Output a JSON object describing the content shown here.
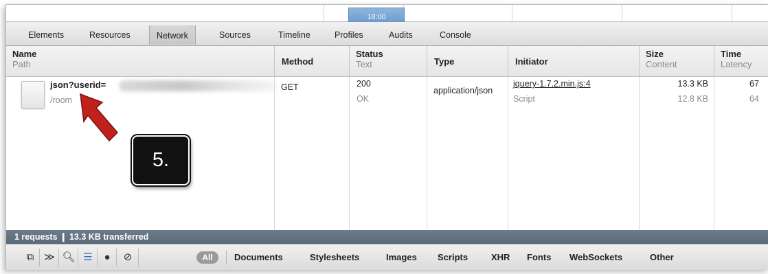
{
  "page_strip": {
    "time_label": "18:00"
  },
  "tabs": [
    {
      "label": "Elements",
      "active": false
    },
    {
      "label": "Resources",
      "active": false
    },
    {
      "label": "Network",
      "active": true
    },
    {
      "label": "Sources",
      "active": false
    },
    {
      "label": "Timeline",
      "active": false
    },
    {
      "label": "Profiles",
      "active": false
    },
    {
      "label": "Audits",
      "active": false
    },
    {
      "label": "Console",
      "active": false
    }
  ],
  "columns": {
    "name": {
      "title": "Name",
      "sub": "Path"
    },
    "method": {
      "title": "Method"
    },
    "status": {
      "title": "Status",
      "sub": "Text"
    },
    "type": {
      "title": "Type"
    },
    "initiator": {
      "title": "Initiator"
    },
    "size": {
      "title": "Size",
      "sub": "Content"
    },
    "time": {
      "title": "Time",
      "sub": "Latency"
    }
  },
  "request": {
    "name": "json?userid=",
    "path": "/room",
    "method": "GET",
    "status_code": "200",
    "status_text": "OK",
    "type": "application/json",
    "initiator": "jquery-1.7.2.min.js:4",
    "initiator_type": "Script",
    "size": "13.3 KB",
    "content": "12.8 KB",
    "time": "67",
    "latency": "64"
  },
  "annotation": {
    "step": "5."
  },
  "status_bar": {
    "summary": "1 requests  ❙  13.3 KB transferred"
  },
  "bottom": {
    "all_label": "All",
    "filters": [
      "Documents",
      "Stylesheets",
      "Images",
      "Scripts",
      "XHR",
      "Fonts",
      "WebSockets",
      "Other"
    ]
  },
  "colors": {
    "status_bar": "#5f6e7d",
    "annotation_arrow": "#c0221b",
    "time_block": "#7aa5d4"
  }
}
